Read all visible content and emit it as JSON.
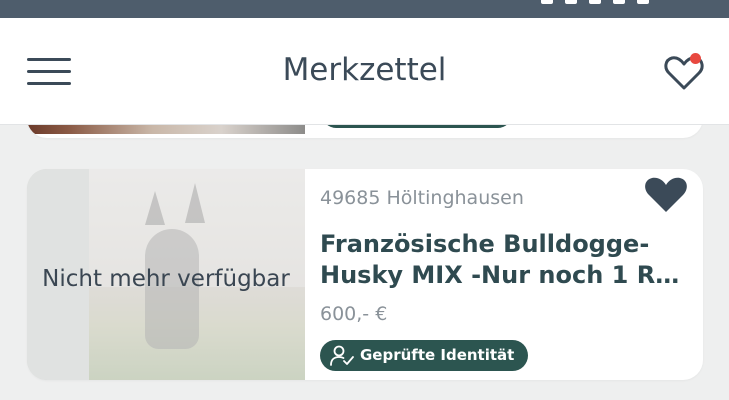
{
  "header": {
    "title": "Merkzettel"
  },
  "listing": {
    "location": "49685 Höltinghausen",
    "title_line1": "Französische Bulldogge-",
    "title_line2": "Husky MIX -Nur noch 1 Rüd…",
    "price": "600,- €",
    "badge": "Geprüfte Identität",
    "unavailable_label": "Nicht mehr verfügbar"
  },
  "colors": {
    "accent_dark": "#2c5550",
    "notification_dot": "#e8483f",
    "heart": "#3b4a58"
  },
  "icons": {
    "menu": "hamburger-menu-icon",
    "favorites": "heart-outline-icon",
    "listing_favorite": "heart-filled-icon",
    "badge": "verified-user-icon"
  }
}
